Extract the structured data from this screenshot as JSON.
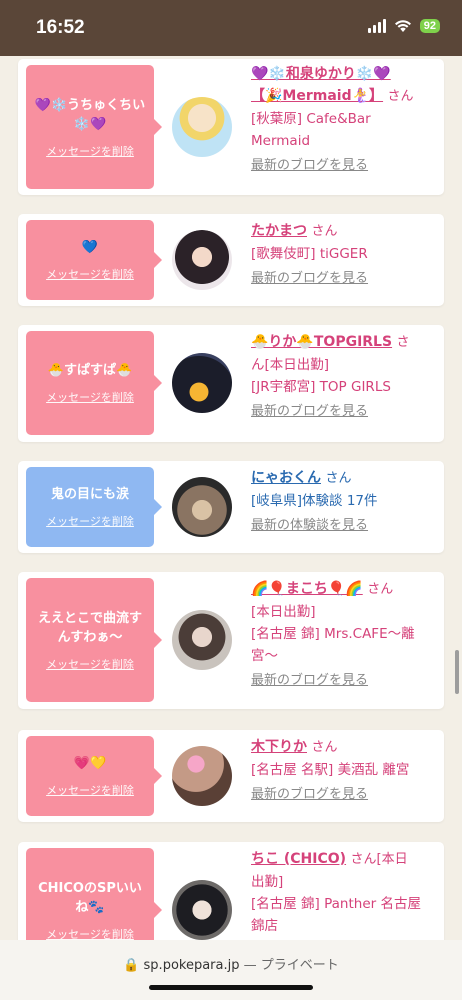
{
  "status": {
    "time": "16:52",
    "battery": "92"
  },
  "browser": {
    "domain": "sp.pokepara.jp",
    "separator": "—",
    "private_label": "プライベート"
  },
  "delete_label": "メッセージを削除",
  "cards": [
    {
      "msg": "💜❄️うちゅくちい❄️💜",
      "name_line1": "💜❄️和泉ゆかり❄️💜",
      "name_line2": "【🎉Mermaid🧜‍♀️】",
      "san": "さん",
      "shop_lines": [
        "[秋葉原] Cafe&Bar",
        "Mermaid"
      ],
      "link": "最新のブログを見る"
    },
    {
      "msg": "💙",
      "name_line1": "たかまつ",
      "san": "さん",
      "shop_lines": [
        "[歌舞伎町] tiGGER"
      ],
      "link": "最新のブログを見る"
    },
    {
      "msg": "🐣すぱすぱ🐣",
      "name_line1": "🐣りか🐣TOPGIRLS",
      "san": "さ",
      "shop_lines": [
        "ん[本日出勤]",
        "[JR宇都宮] TOP GIRLS"
      ],
      "link": "最新のブログを見る"
    },
    {
      "msg": "鬼の目にも涙",
      "name_line1": "にゃおくん",
      "san": "さん",
      "shop_lines": [
        "[岐阜県]体験談 17件"
      ],
      "link": "最新の体験談を見る"
    },
    {
      "msg": "ええとこで曲流すんすわぁ〜",
      "name_line1": "🌈🎈まこち🎈🌈",
      "san": "さん",
      "shop_lines": [
        "[本日出勤]",
        "[名古屋 錦] Mrs.CAFE〜離",
        "宮〜"
      ],
      "link": "最新のブログを見る"
    },
    {
      "msg": "💗💛",
      "name_line1": "木下りか",
      "san": "さん",
      "shop_lines": [
        "[名古屋 名駅] 美酒乱 離宮"
      ],
      "link": "最新のブログを見る"
    },
    {
      "msg": "CHICOのSPいいね🐾",
      "name_line1": "ちこ (CHICO)",
      "san": "さん",
      "after_san": "[本日",
      "shop_lines": [
        "出勤]",
        "[名古屋 錦] Panther 名古屋",
        "錦店"
      ],
      "link": ""
    }
  ]
}
